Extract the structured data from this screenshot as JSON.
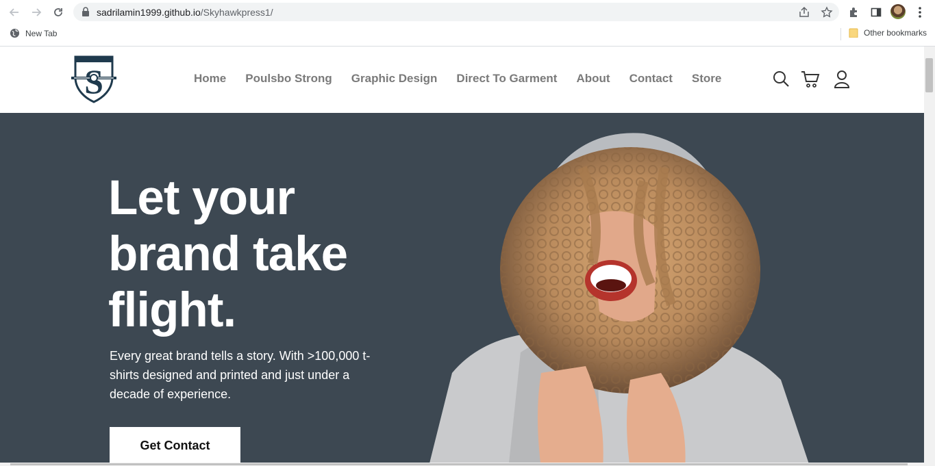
{
  "browser": {
    "url_host": "sadrilamin1999.github.io",
    "url_path": "/Skyhawkpress1/",
    "bookmarks": {
      "new_tab": "New Tab",
      "other": "Other bookmarks"
    }
  },
  "site": {
    "nav": [
      "Home",
      "Poulsbo Strong",
      "Graphic Design",
      "Direct To Garment",
      "About",
      "Contact",
      "Store"
    ],
    "hero": {
      "title_line1": "Let your",
      "title_line2": "brand take",
      "title_line3": "flight.",
      "text": "Every great brand tells a story. With >100,000 t-shirts designed and printed and just under a decade of experience.",
      "button": "Get Contact"
    }
  },
  "colors": {
    "hero_bg": "#3d4852",
    "nav_text": "#7a7a7a",
    "logo_navy": "#1f3a4d"
  },
  "icons": [
    "back-icon",
    "forward-icon",
    "reload-icon",
    "lock-icon",
    "share-icon",
    "star-icon",
    "extensions-icon",
    "sidepanel-icon",
    "menu-icon",
    "globe-icon",
    "folder-icon",
    "search-icon",
    "cart-icon",
    "user-icon"
  ]
}
